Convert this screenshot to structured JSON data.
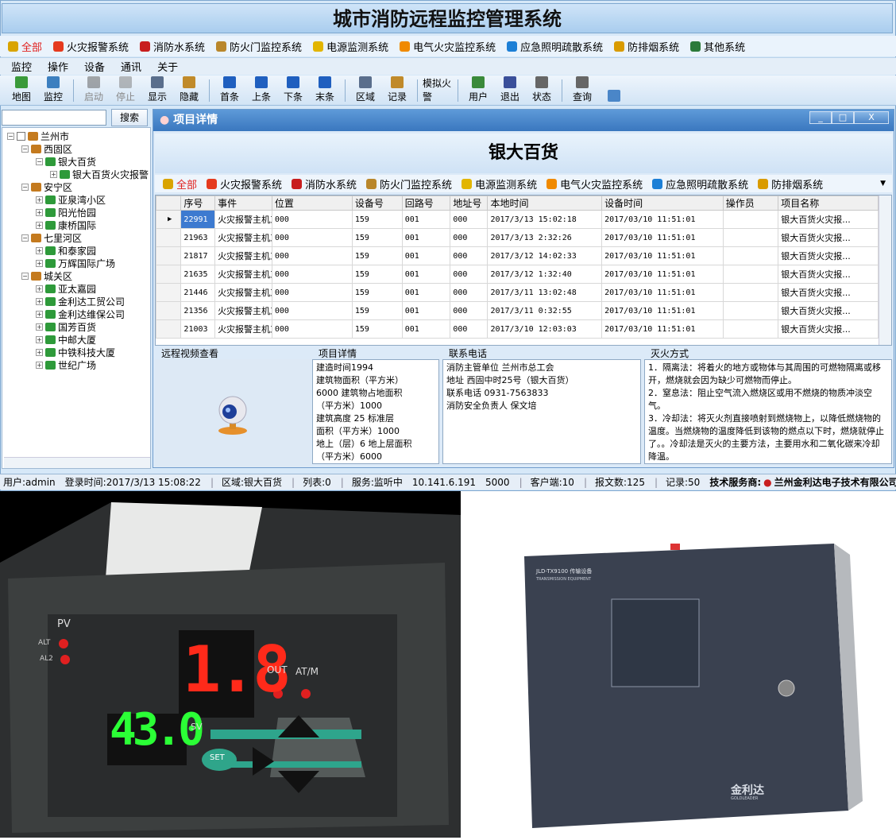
{
  "app_title": "城市消防远程监控管理系统",
  "systems": [
    {
      "label": "全部",
      "icon": "all-icon",
      "color": "#d9a400"
    },
    {
      "label": "火灾报警系统",
      "icon": "fire-alarm-icon",
      "color": "#e53a1e"
    },
    {
      "label": "消防水系统",
      "icon": "water-arrow-icon",
      "color": "#c81e1e"
    },
    {
      "label": "防火门监控系统",
      "icon": "door-icon",
      "color": "#b9872b"
    },
    {
      "label": "电源监测系统",
      "icon": "warning-icon",
      "color": "#e2b500"
    },
    {
      "label": "电气火灾监控系统",
      "icon": "flame-icon",
      "color": "#f08a00"
    },
    {
      "label": "应急照明疏散系统",
      "icon": "light-icon",
      "color": "#1c7fd6"
    },
    {
      "label": "防排烟系统",
      "icon": "fan-icon",
      "color": "#d99b00"
    },
    {
      "label": "其他系统",
      "icon": "globe-icon",
      "color": "#2b7a3a"
    }
  ],
  "menu": [
    "监控",
    "操作",
    "设备",
    "通讯",
    "关于"
  ],
  "toolbar": [
    {
      "label": "地图",
      "icon": "map-pin-icon",
      "color": "#3a9a3a",
      "enabled": true
    },
    {
      "label": "监控",
      "icon": "monitor-icon",
      "color": "#3c7fbf",
      "enabled": true
    },
    {
      "sep": true
    },
    {
      "label": "启动",
      "icon": "start-icon",
      "color": "#555",
      "enabled": false
    },
    {
      "label": "停止",
      "icon": "stop-icon",
      "color": "#777",
      "enabled": false
    },
    {
      "label": "显示",
      "icon": "display-icon",
      "color": "#5a6e8c",
      "enabled": true
    },
    {
      "label": "隐藏",
      "icon": "hide-icon",
      "color": "#c08a2a",
      "enabled": true
    },
    {
      "sep": true
    },
    {
      "label": "首条",
      "icon": "first-icon",
      "color": "#1f5fbf",
      "enabled": true
    },
    {
      "label": "上条",
      "icon": "prev-icon",
      "color": "#1f5fbf",
      "enabled": true
    },
    {
      "label": "下条",
      "icon": "next-icon",
      "color": "#1f5fbf",
      "enabled": true
    },
    {
      "label": "末条",
      "icon": "last-icon",
      "color": "#1f5fbf",
      "enabled": true
    },
    {
      "sep": true
    },
    {
      "label": "区域",
      "icon": "area-icon",
      "color": "#5a6e8c",
      "enabled": true
    },
    {
      "label": "记录",
      "icon": "record-icon",
      "color": "#c08a2a",
      "enabled": true
    },
    {
      "sep": true
    },
    {
      "label": "模拟火警",
      "icon": "fire-sim-icon",
      "color": "#c81e1e",
      "enabled": true
    },
    {
      "sep": true
    },
    {
      "label": "用户",
      "icon": "user-icon",
      "color": "#3a8a3a",
      "enabled": true
    },
    {
      "label": "退出",
      "icon": "exit-icon",
      "color": "#3a4f9a",
      "enabled": true
    },
    {
      "label": "状态",
      "icon": "status-icon",
      "color": "#666",
      "enabled": true
    },
    {
      "sep": true
    },
    {
      "label": "查询",
      "icon": "query-icon",
      "color": "#666",
      "enabled": true
    },
    {
      "label": "",
      "icon": "image-icon",
      "color": "#4a86c8",
      "enabled": true
    }
  ],
  "search": {
    "placeholder": "",
    "button": "搜索"
  },
  "tree": [
    {
      "label": "兰州市",
      "level": 0,
      "type": "city"
    },
    {
      "label": "西固区",
      "level": 1,
      "type": "home"
    },
    {
      "label": "银大百货",
      "level": 2,
      "type": "device"
    },
    {
      "label": "银大百货火灾报警",
      "level": 3,
      "type": "monitor"
    },
    {
      "label": "安宁区",
      "level": 1,
      "type": "home"
    },
    {
      "label": "亚泉湾小区",
      "level": 2,
      "type": "device"
    },
    {
      "label": "阳光怡园",
      "level": 2,
      "type": "device"
    },
    {
      "label": "康桥国际",
      "level": 2,
      "type": "device"
    },
    {
      "label": "七里河区",
      "level": 1,
      "type": "home"
    },
    {
      "label": "和泰家园",
      "level": 2,
      "type": "device"
    },
    {
      "label": "万辉国际广场",
      "level": 2,
      "type": "device"
    },
    {
      "label": "城关区",
      "level": 1,
      "type": "home"
    },
    {
      "label": "亚太嘉园",
      "level": 2,
      "type": "device"
    },
    {
      "label": "金利达工贸公司",
      "level": 2,
      "type": "device"
    },
    {
      "label": "金利达维保公司",
      "level": 2,
      "type": "device"
    },
    {
      "label": "国芳百货",
      "level": 2,
      "type": "device"
    },
    {
      "label": "中邮大厦",
      "level": 2,
      "type": "device"
    },
    {
      "label": "中铁科技大厦",
      "level": 2,
      "type": "device"
    },
    {
      "label": "世纪广场",
      "level": 2,
      "type": "device"
    }
  ],
  "detail": {
    "window_title": "项目详情",
    "project_name": "银大百货",
    "subsystems": [
      "全部",
      "火灾报警系统",
      "消防水系统",
      "防火门监控系统",
      "电源监测系统",
      "电气火灾监控系统",
      "应急照明疏散系统",
      "防排烟系统"
    ],
    "columns": [
      "序号",
      "事件",
      "位置",
      "设备号",
      "回路号",
      "地址号",
      "本地时间",
      "设备时间",
      "操作员",
      "项目名称"
    ],
    "rows": [
      [
        "22991",
        "火灾报警主机工...",
        "000",
        "159",
        "001",
        "000",
        "2017/3/13 15:02:18",
        "2017/03/10 11:51:01",
        "",
        "银大百货火灾报..."
      ],
      [
        "21963",
        "火灾报警主机工...",
        "000",
        "159",
        "001",
        "000",
        "2017/3/13 2:32:26",
        "2017/03/10 11:51:01",
        "",
        "银大百货火灾报..."
      ],
      [
        "21817",
        "火灾报警主机工...",
        "000",
        "159",
        "001",
        "000",
        "2017/3/12 14:02:33",
        "2017/03/10 11:51:01",
        "",
        "银大百货火灾报..."
      ],
      [
        "21635",
        "火灾报警主机工...",
        "000",
        "159",
        "001",
        "000",
        "2017/3/12 1:32:40",
        "2017/03/10 11:51:01",
        "",
        "银大百货火灾报..."
      ],
      [
        "21446",
        "火灾报警主机工...",
        "000",
        "159",
        "001",
        "000",
        "2017/3/11 13:02:48",
        "2017/03/10 11:51:01",
        "",
        "银大百货火灾报..."
      ],
      [
        "21356",
        "火灾报警主机工...",
        "000",
        "159",
        "001",
        "000",
        "2017/3/11 0:32:55",
        "2017/03/10 11:51:01",
        "",
        "银大百货火灾报..."
      ],
      [
        "21003",
        "火灾报警主机工...",
        "000",
        "159",
        "001",
        "000",
        "2017/3/10 12:03:03",
        "2017/03/10 11:51:01",
        "",
        "银大百货火灾报..."
      ]
    ],
    "video_title": "远程视频查看",
    "info_title": "项目详情",
    "info_lines": [
      "建造时间1994",
      "建筑物面积（平方米）",
      "6000  建筑物占地面积",
      "（平方米）1000",
      "建筑高度 25   标准层",
      "面积（平方米）1000",
      "地上（层）6 地上层面积",
      "（平方米）6000"
    ],
    "contact_title": "联系电话",
    "contact_lines": [
      "消防主管单位 兰州市总工会",
      "地址  西固中时25号（银大百货）",
      "联系电话 0931-7563833",
      "消防安全负责人  保文培"
    ],
    "extinguish_title": "灭火方式",
    "extinguish_lines": [
      "    1．隔离法：将着火的地方或物体与其周围的可燃物隔离或移开，燃烧就会因为缺少可燃物而停止。",
      "    2．窒息法：阻止空气流入燃烧区或用不燃烧的物质冲淡空气。",
      "    3．冷却法：将灭火剂直接喷射到燃烧物上，以降低燃烧物的温度。当燃烧物的温度降低到该物的燃点以下时，燃烧就停止了。。冷却法是灭火的主要方法，主要用水和二氧化碳来冷却降温。"
    ]
  },
  "status": [
    "用户:admin",
    "登录时间:2017/3/13 15:08:22",
    "区域:银大百货",
    "列表:0",
    "服务:监听中",
    "10.141.6.191",
    "5000",
    "客户端:10",
    "报文数:125",
    "记录:50"
  ],
  "provider_label": "技术服务商:",
  "provider_name": "兰州金利达电子技术有限公司",
  "controller": {
    "top_reading": "1.8",
    "bottom_reading": "43.0",
    "labels": [
      "PV",
      "ALT",
      "AL2",
      "OUT",
      "AT/M",
      "SV",
      "SET"
    ]
  },
  "box": {
    "model": "JLD-TX9100 传输设备",
    "sub": "TRANSMISSION EQUIPMENT",
    "brand": "金利达",
    "brand_en": "GOLDLEADER"
  }
}
